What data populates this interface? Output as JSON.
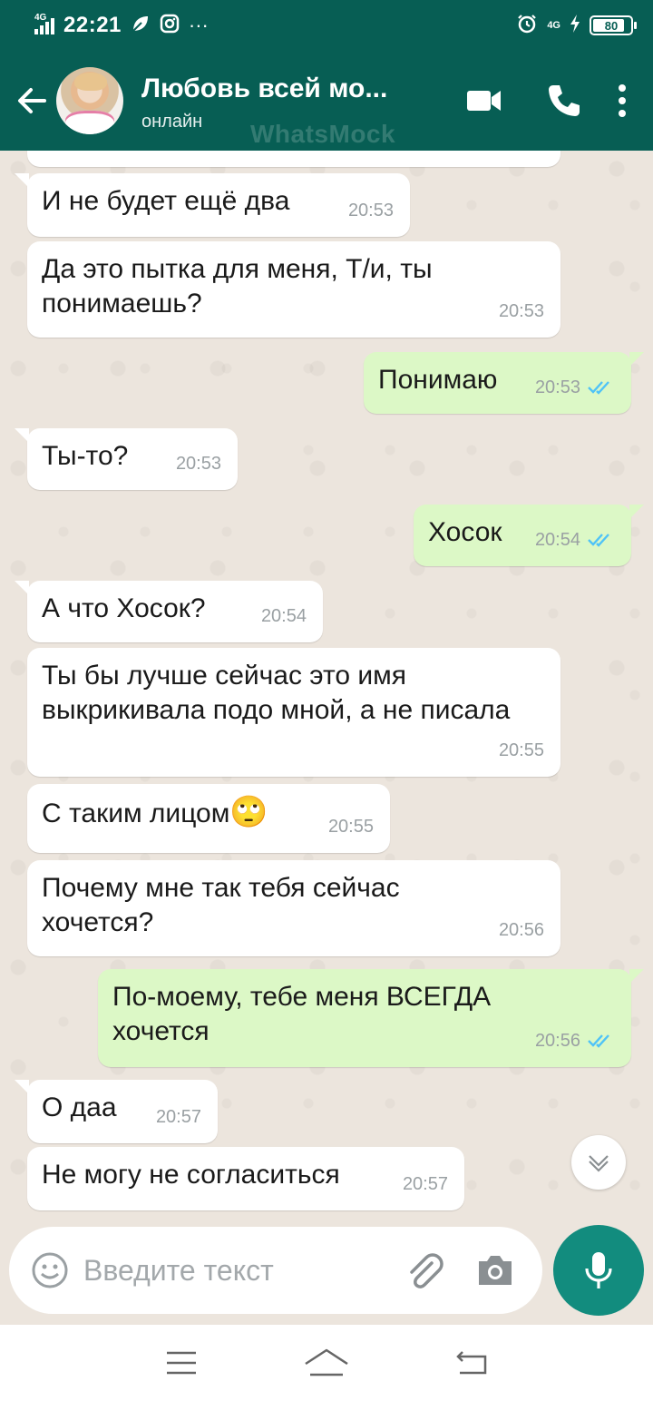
{
  "status_bar": {
    "network": "4G",
    "time": "22:21",
    "more": "···",
    "network_right": "4G",
    "battery": "80"
  },
  "header": {
    "contact_name": "Любовь всей мо...",
    "status": "онлайн",
    "watermark": "WhatsMock"
  },
  "messages": [
    {
      "dir": "in",
      "text": "И не будет ещё два",
      "time": "20:53"
    },
    {
      "dir": "in",
      "text": "Да это пытка для меня, Т/и, ты\nпонимаешь?",
      "time": "20:53"
    },
    {
      "dir": "out",
      "text": "Понимаю",
      "time": "20:53"
    },
    {
      "dir": "in",
      "text": "Ты-то?",
      "time": "20:53"
    },
    {
      "dir": "out",
      "text": "Хосок",
      "time": "20:54"
    },
    {
      "dir": "in",
      "text": "А что Хосок?",
      "time": "20:54"
    },
    {
      "dir": "in",
      "text": "Ты бы лучше сейчас это имя\nвыкрикивала подо мной, а не писала",
      "time": "20:55"
    },
    {
      "dir": "in",
      "text": "С таким лицом",
      "emoji": "🙄",
      "time": "20:55"
    },
    {
      "dir": "in",
      "text": "Почему мне так тебя сейчас\nхочется?",
      "time": "20:56"
    },
    {
      "dir": "out",
      "text": "По-моему, тебе меня ВСЕГДА\nхочется",
      "time": "20:56"
    },
    {
      "dir": "in",
      "text": "О даа",
      "time": "20:57"
    },
    {
      "dir": "in",
      "text": "Не могу не согласиться",
      "time": "20:57"
    }
  ],
  "input": {
    "placeholder": "Введите текст"
  },
  "icons": {
    "back": "arrow-left-icon",
    "video": "video-camera-icon",
    "call": "phone-icon",
    "menu": "more-vert-icon",
    "emoji": "smiley-icon",
    "attach": "paperclip-icon",
    "camera": "camera-icon",
    "mic": "microphone-icon",
    "scroll": "chevron-down-icon"
  },
  "colors": {
    "header": "#075e54",
    "outgoing_bubble": "#dcf8c6",
    "incoming_bubble": "#ffffff",
    "chat_bg": "#ece5dd",
    "read_ticks": "#4fc3f7",
    "mic_button": "#128c7e"
  }
}
